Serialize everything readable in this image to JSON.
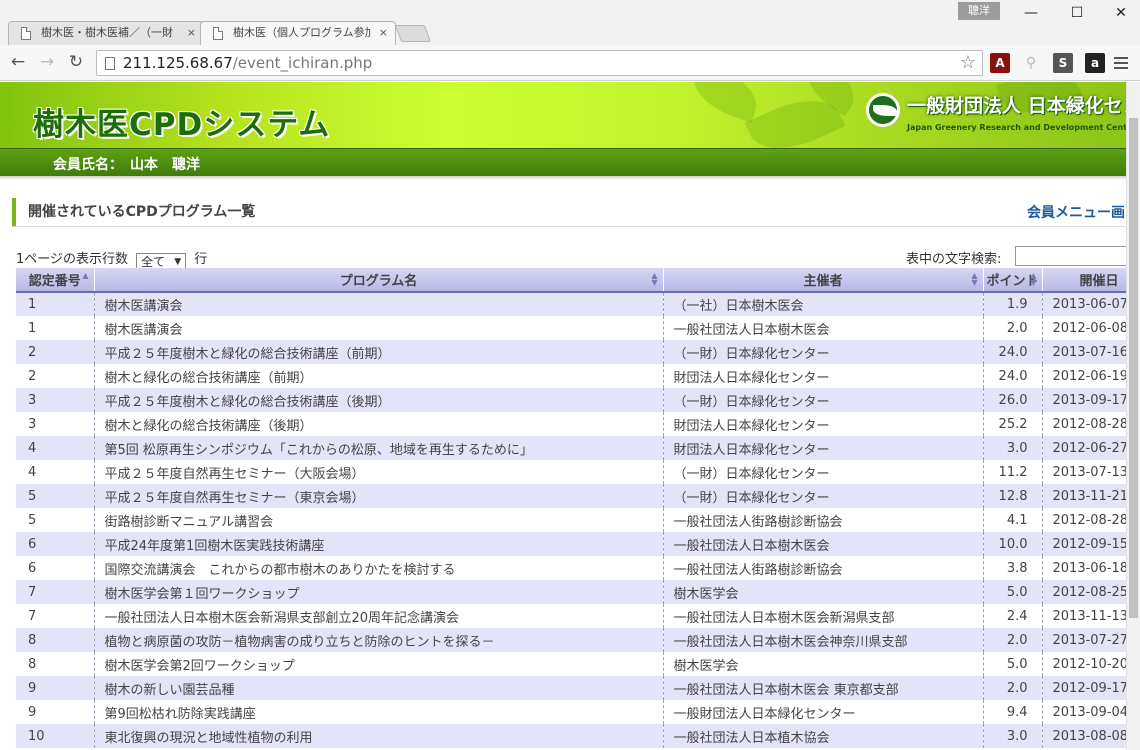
{
  "browser": {
    "tabs": [
      {
        "title": "樹木医・樹木医補／（一財",
        "close": "×"
      },
      {
        "title": "樹木医（個人プログラム参加",
        "close": "×"
      }
    ],
    "profile_name": "聰洋",
    "window_controls": {
      "minimize": "—",
      "maximize": "☐",
      "close": "✕"
    },
    "nav": {
      "back": "←",
      "forward": "→",
      "reload": "↻"
    },
    "url_host": "211.125.68.67",
    "url_path": "/event_ichiran.php",
    "star": "☆",
    "extensions": [
      {
        "icon": "pdf-icon",
        "glyph": "⬛",
        "color": "#8a1010"
      },
      {
        "icon": "search-extension-icon",
        "glyph": "○",
        "color": "#bbbbbb"
      },
      {
        "icon": "s-extension-icon",
        "glyph": "S",
        "color": "#555555"
      },
      {
        "icon": "amazon-icon",
        "glyph": "a",
        "color": "#222222"
      }
    ]
  },
  "header": {
    "site_title": "樹木医CPDシステム",
    "org_name": "一般財団法人 日本緑化セン",
    "org_name_en": "Japan Greenery Research and Development Center",
    "member_label": "会員氏名：",
    "member_name": "山本　聰洋"
  },
  "section": {
    "title": "開催されているCPDプログラム一覧",
    "menu_link": "会員メニュー画"
  },
  "controls": {
    "rows_label_before": "1ページの表示行数",
    "rows_value": "全て",
    "rows_label_after": "行",
    "search_label": "表中の文字検索:"
  },
  "table": {
    "columns": [
      "認定番号",
      "プログラム名",
      "主催者",
      "ポイント",
      "開催日"
    ],
    "rows": [
      [
        "1",
        "樹木医講演会",
        "（一社）日本樹木医会",
        "1.9",
        "2013-06-07"
      ],
      [
        "1",
        "樹木医講演会",
        "一般社団法人日本樹木医会",
        "2.0",
        "2012-06-08"
      ],
      [
        "2",
        "平成２５年度樹木と緑化の総合技術講座（前期）",
        "（一財）日本緑化センター",
        "24.0",
        "2013-07-16"
      ],
      [
        "2",
        "樹木と緑化の総合技術講座（前期）",
        "財団法人日本緑化センター",
        "24.0",
        "2012-06-19"
      ],
      [
        "3",
        "平成２５年度樹木と緑化の総合技術講座（後期）",
        "（一財）日本緑化センター",
        "26.0",
        "2013-09-17"
      ],
      [
        "3",
        "樹木と緑化の総合技術講座（後期）",
        "財団法人日本緑化センター",
        "25.2",
        "2012-08-28"
      ],
      [
        "4",
        "第5回 松原再生シンポジウム「これからの松原、地域を再生するために」",
        "財団法人日本緑化センター",
        "3.0",
        "2012-06-27"
      ],
      [
        "4",
        "平成２５年度自然再生セミナー（大阪会場）",
        "（一財）日本緑化センター",
        "11.2",
        "2013-07-13"
      ],
      [
        "5",
        "平成２５年度自然再生セミナー（東京会場）",
        "（一財）日本緑化センター",
        "12.8",
        "2013-11-21"
      ],
      [
        "5",
        "街路樹診断マニュアル講習会",
        "一般社団法人街路樹診断協会",
        "4.1",
        "2012-08-28"
      ],
      [
        "6",
        "平成24年度第1回樹木医実践技術講座",
        "一般社団法人日本樹木医会",
        "10.0",
        "2012-09-15"
      ],
      [
        "6",
        "国際交流講演会　これからの都市樹木のありかたを検討する",
        "一般社団法人街路樹診断協会",
        "3.8",
        "2013-06-18"
      ],
      [
        "7",
        "樹木医学会第１回ワークショップ",
        "樹木医学会",
        "5.0",
        "2012-08-25"
      ],
      [
        "7",
        "一般社団法人日本樹木医会新潟県支部創立20周年記念講演会",
        "一般社団法人日本樹木医会新潟県支部",
        "2.4",
        "2013-11-13"
      ],
      [
        "8",
        "植物と病原菌の攻防－植物病害の成り立ちと防除のヒントを探る－",
        "一般社団法人日本樹木医会神奈川県支部",
        "2.0",
        "2013-07-27"
      ],
      [
        "8",
        "樹木医学会第2回ワークショップ",
        "樹木医学会",
        "5.0",
        "2012-10-20"
      ],
      [
        "9",
        "樹木の新しい園芸品種",
        "一般社団法人日本樹木医会 東京都支部",
        "2.0",
        "2012-09-17"
      ],
      [
        "9",
        "第9回松枯れ防除実践講座",
        "一般財団法人日本緑化センター",
        "9.4",
        "2013-09-04"
      ],
      [
        "10",
        "東北復興の現況と地域性植物の利用",
        "一般社団法人日本植木協会",
        "3.0",
        "2013-08-08"
      ]
    ]
  }
}
